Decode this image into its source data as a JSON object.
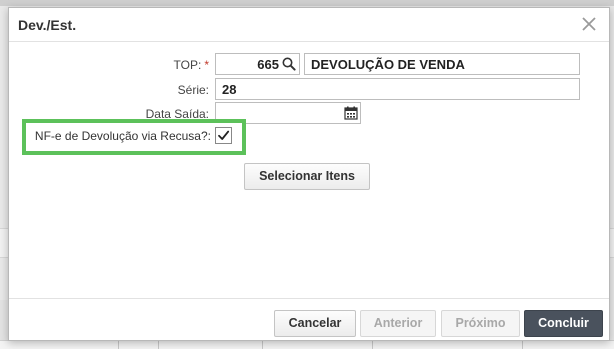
{
  "dialog": {
    "title": "Dev./Est.",
    "close_icon": "close-icon"
  },
  "form": {
    "top_label": "TOP:",
    "top_required_mark": "*",
    "top_code": "665",
    "top_search_icon": "search-icon",
    "top_description": "DEVOLUÇÃO DE VENDA",
    "serie_label": "Série:",
    "serie_value": "28",
    "data_saida_label": "Data Saída:",
    "data_saida_value": "",
    "calendar_icon": "calendar-icon",
    "nfe_recusa_label": "NF-e de Devolução via Recusa?:",
    "nfe_recusa_checked": true,
    "highlight_color": "#5cc15a"
  },
  "buttons": {
    "selecionar_itens": "Selecionar Itens",
    "cancelar": "Cancelar",
    "anterior": "Anterior",
    "proximo": "Próximo",
    "concluir": "Concluir"
  },
  "colors": {
    "primary_button": "#4a525d",
    "required": "#c0392b"
  }
}
